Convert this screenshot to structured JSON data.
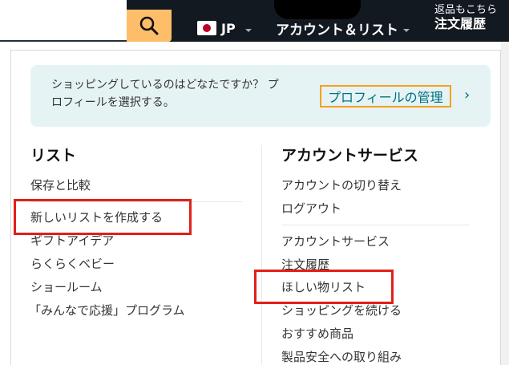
{
  "nav": {
    "locale": "JP",
    "account_label": "アカウント＆リスト",
    "orders_line1": "返品もこちら",
    "orders_line2": "注文履歴",
    "accent_color": "#febd69",
    "bar_color": "#131921"
  },
  "profile_banner": {
    "prompt_line1": "ショッピングしているのはどなたですか？ プ",
    "prompt_line2": "ロフィールを選択する。",
    "manage_button": "プロフィールの管理",
    "chevron": "›"
  },
  "lists": {
    "title": "リスト",
    "items": [
      "保存と比較",
      "新しいリストを作成する",
      "ギフトアイデア",
      "らくらくベビー",
      "ショールーム",
      "「みんなで応援」プログラム"
    ]
  },
  "account_services": {
    "title": "アカウントサービス",
    "items": [
      "アカウントの切り替え",
      "ログアウト",
      "アカウントサービス",
      "注文履歴",
      "ほしい物リスト",
      "ショッピングを続ける",
      "おすすめ商品",
      "製品安全への取り組み"
    ]
  },
  "highlight_color": "#e0201a",
  "link_color": "#007185"
}
